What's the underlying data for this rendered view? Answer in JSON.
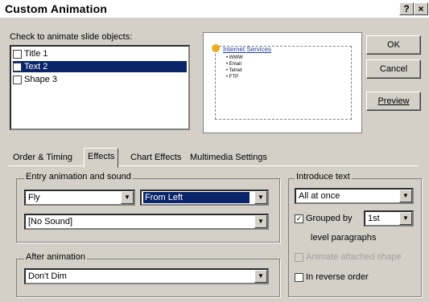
{
  "window": {
    "title": "Custom Animation",
    "help_btn": "?",
    "close_btn": "×"
  },
  "objects": {
    "label": "Check to animate slide objects:",
    "items": [
      {
        "label": "Title 1",
        "checked": false,
        "selected": false,
        "mark": ""
      },
      {
        "label": "Text 2",
        "checked": true,
        "selected": true,
        "mark": "✓"
      },
      {
        "label": "Shape 3",
        "checked": false,
        "selected": false,
        "mark": ""
      }
    ]
  },
  "preview": {
    "title": "Internet Services",
    "bullets": [
      "WWW",
      "Email",
      "Telnet",
      "FTP"
    ]
  },
  "buttons": {
    "ok": "OK",
    "cancel": "Cancel",
    "preview": "Preview"
  },
  "tabs": [
    "Order & Timing",
    "Effects",
    "Chart Effects",
    "Multimedia Settings"
  ],
  "active_tab": "Effects",
  "entry": {
    "group_label": "Entry animation and sound",
    "effect": "Fly",
    "direction": "From Left",
    "sound": "[No Sound]"
  },
  "after": {
    "group_label": "After animation",
    "value": "Don't Dim"
  },
  "introduce": {
    "group_label": "Introduce text",
    "mode": "All at once",
    "grouped_label": "Grouped by",
    "grouped_checked": true,
    "grouped_mark": "✓",
    "level": "1st",
    "level_suffix": "level paragraphs",
    "animate_shape_label": "Animate attached shape",
    "reverse_label": "In reverse order"
  }
}
